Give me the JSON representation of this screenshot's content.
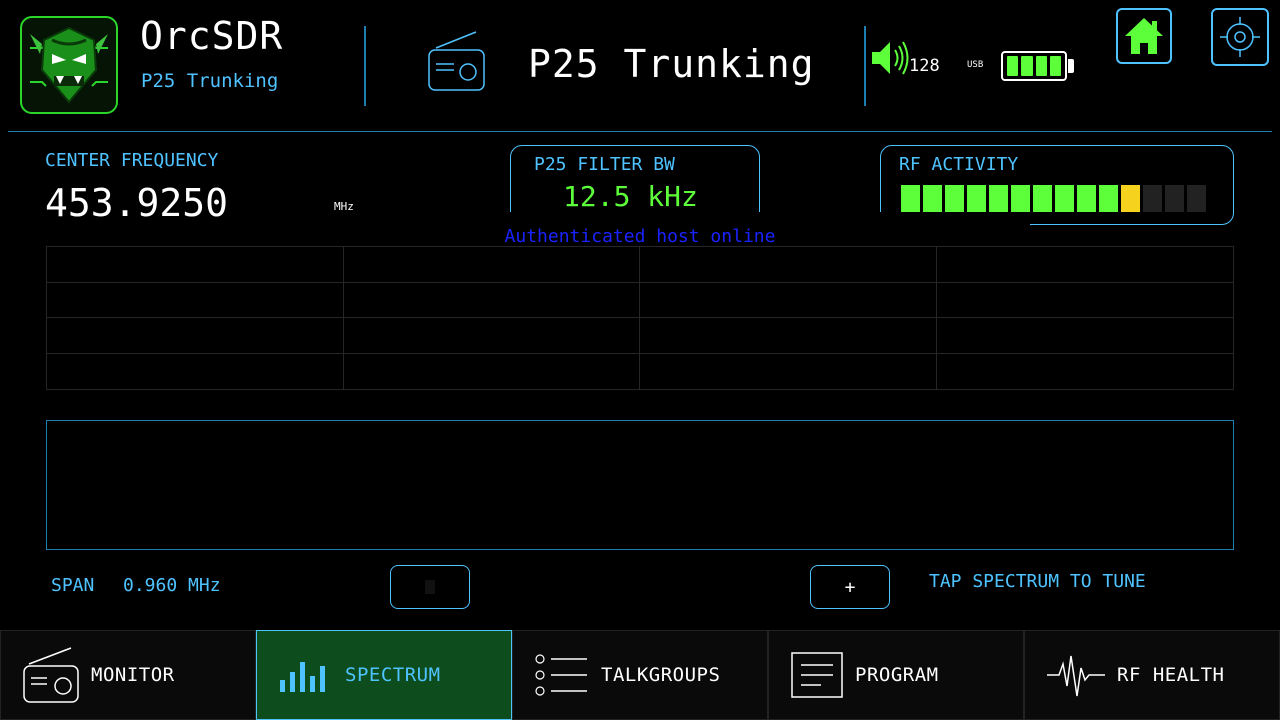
{
  "header": {
    "app_title": "OrcSDR",
    "app_subtitle": "P25 Trunking",
    "mode_title": "P25 Trunking",
    "volume": "128",
    "power_source": "USB",
    "battery_level_fraction": 1.0
  },
  "center_frequency": {
    "label": "CENTER FREQUENCY",
    "value": "453.9250",
    "unit": "MHz"
  },
  "filter_bw": {
    "label": "P25 FILTER BW",
    "value": "12.5 kHz"
  },
  "rf_activity": {
    "label": "RF ACTIVITY",
    "segments_total": 14,
    "segments_green": 10,
    "segments_yellow": 1
  },
  "toast": {
    "message": "Authenticated host online"
  },
  "spectrum": {
    "span_label": "SPAN",
    "span_value": "0.960 MHz",
    "zoom_in_label": "+",
    "tap_hint": "TAP SPECTRUM TO TUNE"
  },
  "nav": {
    "items": [
      {
        "label": "MONITOR",
        "icon": "radio-icon"
      },
      {
        "label": "SPECTRUM",
        "icon": "signal-bars-icon",
        "active": true
      },
      {
        "label": "TALKGROUPS",
        "icon": "list-icon"
      },
      {
        "label": "PROGRAM",
        "icon": "document-icon"
      },
      {
        "label": "RF HEALTH",
        "icon": "pulse-icon"
      }
    ]
  },
  "colors": {
    "accent": "#4fc3ff",
    "green": "#5dff3a",
    "yellow": "#f5d21e",
    "active_nav_bg": "#0d4c1c"
  }
}
